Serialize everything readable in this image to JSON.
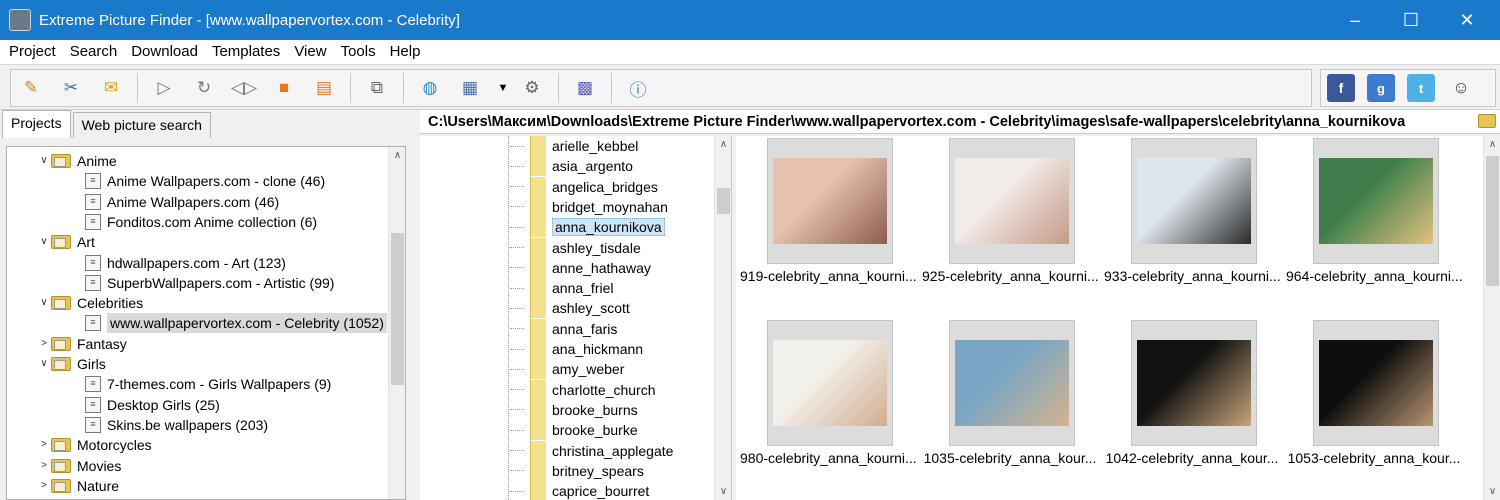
{
  "window": {
    "title": "Extreme Picture Finder - [www.wallpapervortex.com - Celebrity]",
    "minimize_glyph": "–",
    "maximize_glyph": "☐",
    "close_glyph": "✕"
  },
  "menu": [
    "Project",
    "Search",
    "Download",
    "Templates",
    "View",
    "Tools",
    "Help"
  ],
  "toolbar": {
    "icons": [
      "edit-icon",
      "tools-icon",
      "comment-icon",
      "play-icon",
      "refresh-icon",
      "step-icon",
      "stop-icon",
      "queue-icon",
      "copy-icon",
      "globe-icon",
      "window-icon",
      "dropdown-icon",
      "gear-icon",
      "grid-icon",
      "help-icon"
    ],
    "social_icons": [
      "facebook-icon",
      "google-plus-icon",
      "twitter-icon",
      "users-icon"
    ]
  },
  "left_tabs": [
    "Projects",
    "Web picture search"
  ],
  "tree": [
    {
      "type": "folder",
      "label": "Anime",
      "expanded": true
    },
    {
      "type": "project",
      "label": "Anime Wallpapers.com - clone (46)"
    },
    {
      "type": "project",
      "label": "Anime Wallpapers.com (46)"
    },
    {
      "type": "project",
      "label": "Fonditos.com Anime collection (6)"
    },
    {
      "type": "folder",
      "label": "Art",
      "expanded": true
    },
    {
      "type": "project",
      "label": "hdwallpapers.com - Art (123)"
    },
    {
      "type": "project",
      "label": "SuperbWallpapers.com - Artistic (99)"
    },
    {
      "type": "folder",
      "label": "Celebrities",
      "expanded": true
    },
    {
      "type": "project",
      "label": "www.wallpapervortex.com - Celebrity (1052)",
      "selected": true
    },
    {
      "type": "folder",
      "label": "Fantasy",
      "expanded": false
    },
    {
      "type": "folder",
      "label": "Girls",
      "expanded": true
    },
    {
      "type": "project",
      "label": "7-themes.com - Girls Wallpapers (9)"
    },
    {
      "type": "project",
      "label": "Desktop Girls (25)"
    },
    {
      "type": "project",
      "label": "Skins.be wallpapers (203)"
    },
    {
      "type": "folder",
      "label": "Motorcycles",
      "expanded": false
    },
    {
      "type": "folder",
      "label": "Movies",
      "expanded": false
    },
    {
      "type": "folder",
      "label": "Nature",
      "expanded": false
    }
  ],
  "path": "C:\\Users\\Максим\\Downloads\\Extreme Picture Finder\\www.wallpapervortex.com - Celebrity\\images\\safe-wallpapers\\celebrity\\anna_kournikova",
  "folders": [
    {
      "label": "arielle_kebbel"
    },
    {
      "label": "asia_argento"
    },
    {
      "label": "angelica_bridges"
    },
    {
      "label": "bridget_moynahan"
    },
    {
      "label": "anna_kournikova",
      "selected": true
    },
    {
      "label": "ashley_tisdale"
    },
    {
      "label": "anne_hathaway"
    },
    {
      "label": "anna_friel"
    },
    {
      "label": "ashley_scott"
    },
    {
      "label": "anna_faris"
    },
    {
      "label": "ana_hickmann"
    },
    {
      "label": "amy_weber"
    },
    {
      "label": "charlotte_church"
    },
    {
      "label": "brooke_burns"
    },
    {
      "label": "brooke_burke"
    },
    {
      "label": "christina_applegate"
    },
    {
      "label": "britney_spears"
    },
    {
      "label": "caprice_bourret"
    }
  ],
  "thumbnails": [
    {
      "caption": "919-celebrity_anna_kourni...",
      "colors": [
        "#e7c2ae",
        "#8c5e4e"
      ]
    },
    {
      "caption": "925-celebrity_anna_kourni...",
      "colors": [
        "#f2ece8",
        "#c59a86"
      ]
    },
    {
      "caption": "933-celebrity_anna_kourni...",
      "colors": [
        "#dfe7ee",
        "#2a2a2a"
      ]
    },
    {
      "caption": "964-celebrity_anna_kourni...",
      "colors": [
        "#3f7e4c",
        "#e2c27e"
      ]
    },
    {
      "caption": "980-celebrity_anna_kourni...",
      "colors": [
        "#f3f1ec",
        "#d2ad8e"
      ]
    },
    {
      "caption": "1035-celebrity_anna_kour...",
      "colors": [
        "#7aa6c4",
        "#d4b38f"
      ]
    },
    {
      "caption": "1042-celebrity_anna_kour...",
      "colors": [
        "#111111",
        "#c9a57a"
      ]
    },
    {
      "caption": "1053-celebrity_anna_kour...",
      "colors": [
        "#0e0e0e",
        "#b99572"
      ]
    }
  ]
}
